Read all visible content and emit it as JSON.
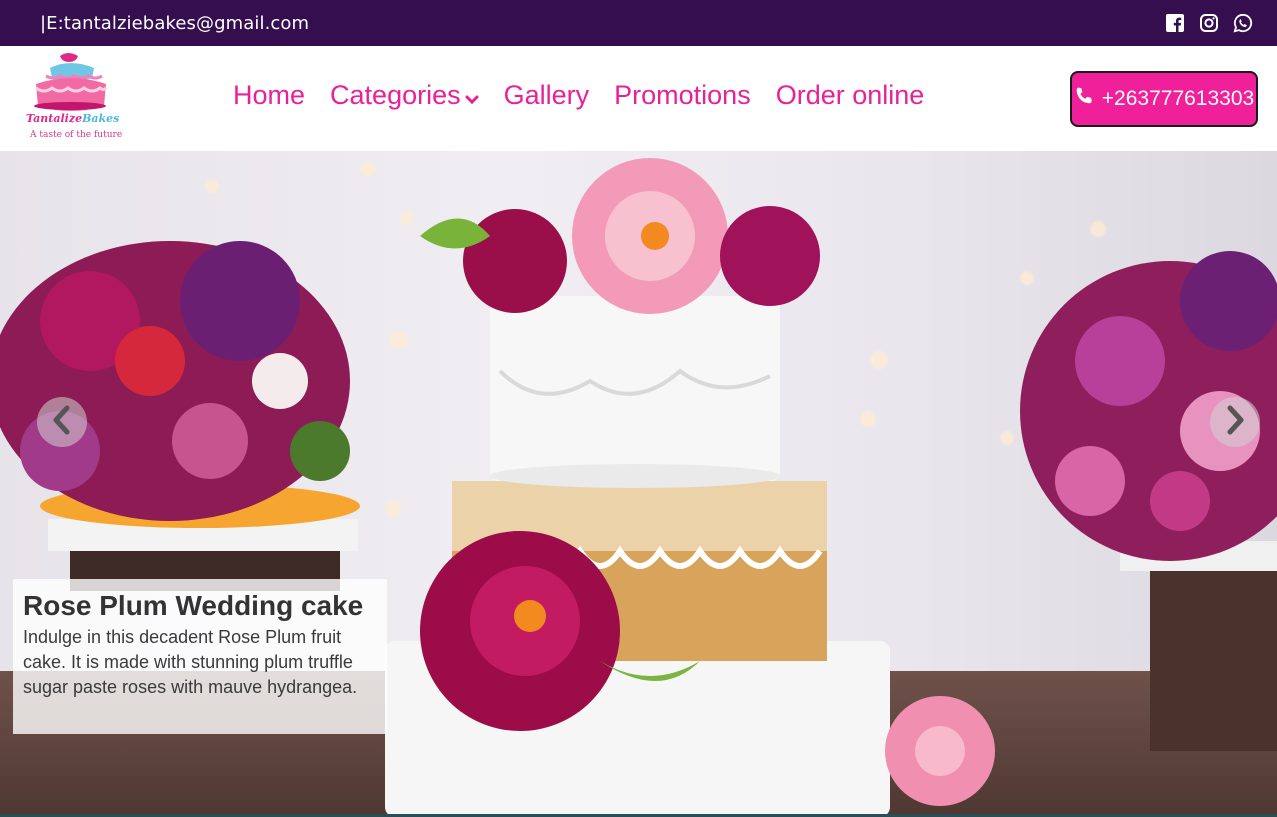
{
  "topbar": {
    "email": "|E:tantalziebakes@gmail.com",
    "socials": [
      {
        "icon": "facebook-icon"
      },
      {
        "icon": "instagram-icon"
      },
      {
        "icon": "whatsapp-icon"
      }
    ]
  },
  "logo": {
    "brand_part1": "Tantalize",
    "brand_part2": "Bakes",
    "tagline": "A taste of the future"
  },
  "nav": {
    "items": [
      {
        "label": "Home"
      },
      {
        "label": "Categories",
        "has_dropdown": true
      },
      {
        "label": "Gallery"
      },
      {
        "label": "Promotions"
      },
      {
        "label": "Order online"
      }
    ]
  },
  "phone_button": {
    "label": "+263777613303",
    "icon": "phone-icon"
  },
  "carousel": {
    "slide": {
      "title": "Rose Plum Wedding cake",
      "description": "Indulge in this decadent Rose Plum fruit cake. It is made with stunning plum truffle sugar paste roses with mauve hydrangea."
    },
    "prev_icon": "chevron-left-icon",
    "next_icon": "chevron-right-icon"
  },
  "colors": {
    "topbar_bg": "#340e4e",
    "nav_text": "#e8219a",
    "button_bg": "#f01f9a"
  }
}
